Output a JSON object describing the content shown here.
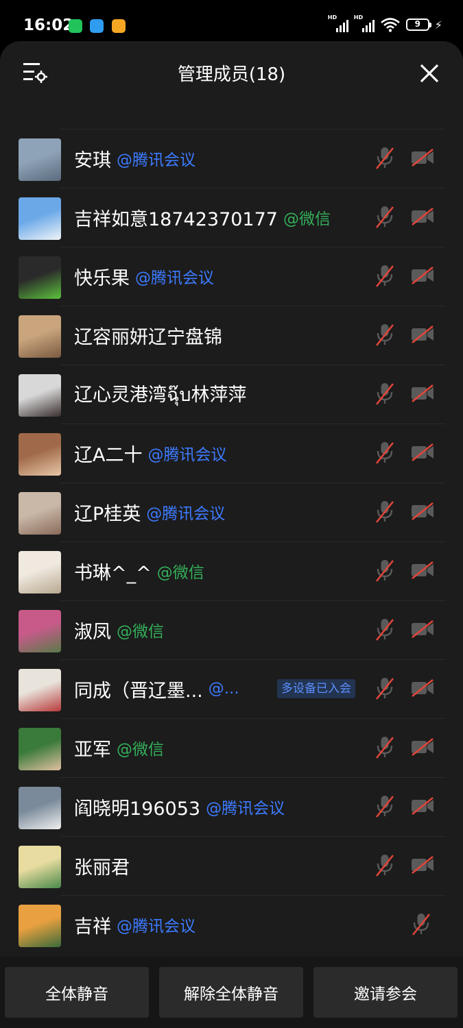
{
  "status_bar": {
    "time": "16:02",
    "signal_1": "HD",
    "signal_2": "HD",
    "battery": "9"
  },
  "header": {
    "title": "管理成员(18)"
  },
  "members": [
    {
      "name": "安琪",
      "source": "@腾讯会议",
      "source_type": "tencent"
    },
    {
      "name": "吉祥如意18742370177",
      "source": "@微信",
      "source_type": "wechat"
    },
    {
      "name": "快乐果",
      "source": "@腾讯会议",
      "source_type": "tencent"
    },
    {
      "name": "辽容丽妍辽宁盘锦",
      "source": "",
      "source_type": ""
    },
    {
      "name": "辽心灵港湾ฉุ๊บ林萍萍",
      "source": "",
      "source_type": ""
    },
    {
      "name": "辽A二十",
      "source": "@腾讯会议",
      "source_type": "tencent"
    },
    {
      "name": "辽P桂英",
      "source": "@腾讯会议",
      "source_type": "tencent"
    },
    {
      "name": "书琳^_^",
      "source": "@微信",
      "source_type": "wechat"
    },
    {
      "name": "淑凤",
      "source": "@微信",
      "source_type": "wechat"
    },
    {
      "name": "同成（晋辽墨...",
      "source": "@...",
      "source_type": "tencent",
      "badge": "多设备已入会"
    },
    {
      "name": "亚军",
      "source": "@微信",
      "source_type": "wechat"
    },
    {
      "name": "阎晓明196053",
      "source": "@腾讯会议",
      "source_type": "tencent"
    },
    {
      "name": "张丽君",
      "source": "",
      "source_type": ""
    },
    {
      "name": "吉祥",
      "source": "@腾讯会议",
      "source_type": "tencent"
    }
  ],
  "buttons": {
    "mute_all": "全体静音",
    "unmute_all": "解除全体静音",
    "invite": "邀请参会"
  },
  "colors": {
    "tencent_link": "#3d7bff",
    "wechat_link": "#33b05a",
    "muted_slash": "#e0453a"
  }
}
